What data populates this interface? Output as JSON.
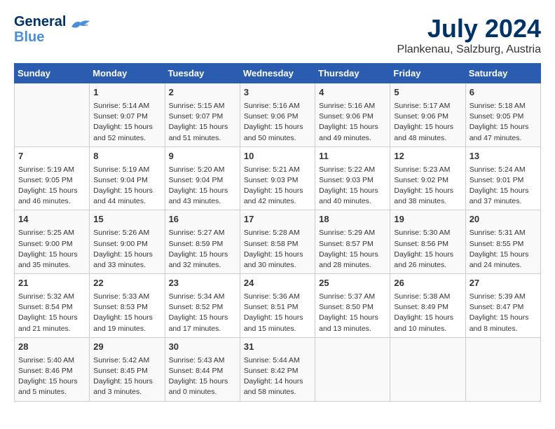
{
  "header": {
    "logo_line1": "General",
    "logo_line2": "Blue",
    "month": "July 2024",
    "location": "Plankenau, Salzburg, Austria"
  },
  "columns": [
    "Sunday",
    "Monday",
    "Tuesday",
    "Wednesday",
    "Thursday",
    "Friday",
    "Saturday"
  ],
  "weeks": [
    [
      {
        "day": "",
        "content": ""
      },
      {
        "day": "1",
        "content": "Sunrise: 5:14 AM\nSunset: 9:07 PM\nDaylight: 15 hours\nand 52 minutes."
      },
      {
        "day": "2",
        "content": "Sunrise: 5:15 AM\nSunset: 9:07 PM\nDaylight: 15 hours\nand 51 minutes."
      },
      {
        "day": "3",
        "content": "Sunrise: 5:16 AM\nSunset: 9:06 PM\nDaylight: 15 hours\nand 50 minutes."
      },
      {
        "day": "4",
        "content": "Sunrise: 5:16 AM\nSunset: 9:06 PM\nDaylight: 15 hours\nand 49 minutes."
      },
      {
        "day": "5",
        "content": "Sunrise: 5:17 AM\nSunset: 9:06 PM\nDaylight: 15 hours\nand 48 minutes."
      },
      {
        "day": "6",
        "content": "Sunrise: 5:18 AM\nSunset: 9:05 PM\nDaylight: 15 hours\nand 47 minutes."
      }
    ],
    [
      {
        "day": "7",
        "content": "Sunrise: 5:19 AM\nSunset: 9:05 PM\nDaylight: 15 hours\nand 46 minutes."
      },
      {
        "day": "8",
        "content": "Sunrise: 5:19 AM\nSunset: 9:04 PM\nDaylight: 15 hours\nand 44 minutes."
      },
      {
        "day": "9",
        "content": "Sunrise: 5:20 AM\nSunset: 9:04 PM\nDaylight: 15 hours\nand 43 minutes."
      },
      {
        "day": "10",
        "content": "Sunrise: 5:21 AM\nSunset: 9:03 PM\nDaylight: 15 hours\nand 42 minutes."
      },
      {
        "day": "11",
        "content": "Sunrise: 5:22 AM\nSunset: 9:03 PM\nDaylight: 15 hours\nand 40 minutes."
      },
      {
        "day": "12",
        "content": "Sunrise: 5:23 AM\nSunset: 9:02 PM\nDaylight: 15 hours\nand 38 minutes."
      },
      {
        "day": "13",
        "content": "Sunrise: 5:24 AM\nSunset: 9:01 PM\nDaylight: 15 hours\nand 37 minutes."
      }
    ],
    [
      {
        "day": "14",
        "content": "Sunrise: 5:25 AM\nSunset: 9:00 PM\nDaylight: 15 hours\nand 35 minutes."
      },
      {
        "day": "15",
        "content": "Sunrise: 5:26 AM\nSunset: 9:00 PM\nDaylight: 15 hours\nand 33 minutes."
      },
      {
        "day": "16",
        "content": "Sunrise: 5:27 AM\nSunset: 8:59 PM\nDaylight: 15 hours\nand 32 minutes."
      },
      {
        "day": "17",
        "content": "Sunrise: 5:28 AM\nSunset: 8:58 PM\nDaylight: 15 hours\nand 30 minutes."
      },
      {
        "day": "18",
        "content": "Sunrise: 5:29 AM\nSunset: 8:57 PM\nDaylight: 15 hours\nand 28 minutes."
      },
      {
        "day": "19",
        "content": "Sunrise: 5:30 AM\nSunset: 8:56 PM\nDaylight: 15 hours\nand 26 minutes."
      },
      {
        "day": "20",
        "content": "Sunrise: 5:31 AM\nSunset: 8:55 PM\nDaylight: 15 hours\nand 24 minutes."
      }
    ],
    [
      {
        "day": "21",
        "content": "Sunrise: 5:32 AM\nSunset: 8:54 PM\nDaylight: 15 hours\nand 21 minutes."
      },
      {
        "day": "22",
        "content": "Sunrise: 5:33 AM\nSunset: 8:53 PM\nDaylight: 15 hours\nand 19 minutes."
      },
      {
        "day": "23",
        "content": "Sunrise: 5:34 AM\nSunset: 8:52 PM\nDaylight: 15 hours\nand 17 minutes."
      },
      {
        "day": "24",
        "content": "Sunrise: 5:36 AM\nSunset: 8:51 PM\nDaylight: 15 hours\nand 15 minutes."
      },
      {
        "day": "25",
        "content": "Sunrise: 5:37 AM\nSunset: 8:50 PM\nDaylight: 15 hours\nand 13 minutes."
      },
      {
        "day": "26",
        "content": "Sunrise: 5:38 AM\nSunset: 8:49 PM\nDaylight: 15 hours\nand 10 minutes."
      },
      {
        "day": "27",
        "content": "Sunrise: 5:39 AM\nSunset: 8:47 PM\nDaylight: 15 hours\nand 8 minutes."
      }
    ],
    [
      {
        "day": "28",
        "content": "Sunrise: 5:40 AM\nSunset: 8:46 PM\nDaylight: 15 hours\nand 5 minutes."
      },
      {
        "day": "29",
        "content": "Sunrise: 5:42 AM\nSunset: 8:45 PM\nDaylight: 15 hours\nand 3 minutes."
      },
      {
        "day": "30",
        "content": "Sunrise: 5:43 AM\nSunset: 8:44 PM\nDaylight: 15 hours\nand 0 minutes."
      },
      {
        "day": "31",
        "content": "Sunrise: 5:44 AM\nSunset: 8:42 PM\nDaylight: 14 hours\nand 58 minutes."
      },
      {
        "day": "",
        "content": ""
      },
      {
        "day": "",
        "content": ""
      },
      {
        "day": "",
        "content": ""
      }
    ]
  ]
}
